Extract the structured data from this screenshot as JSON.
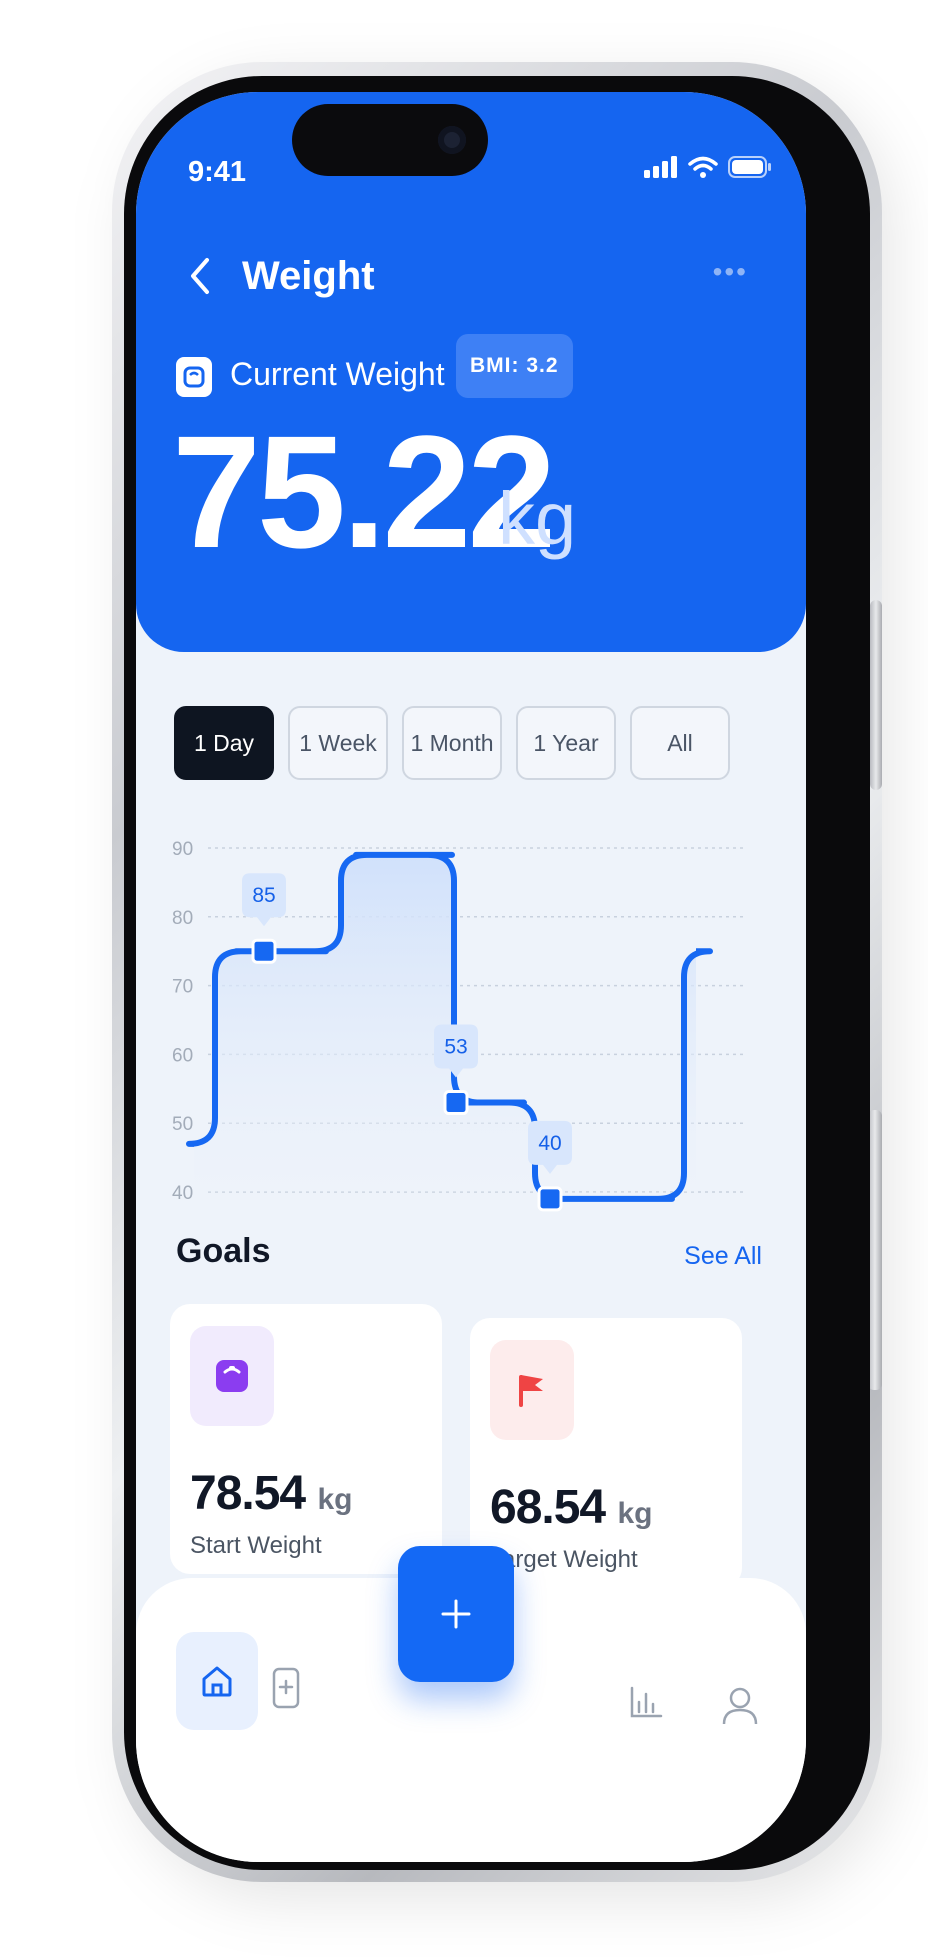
{
  "status": {
    "time": "9:41"
  },
  "header": {
    "title": "Weight",
    "more": "•••",
    "current_label": "Current Weight",
    "bmi": "BMI: 3.2",
    "weight_value": "75.22",
    "weight_unit": "kg"
  },
  "tabs": [
    "1 Day",
    "1 Week",
    "1 Month",
    "1 Year",
    "All"
  ],
  "active_tab": "1 Day",
  "chart_data": {
    "type": "area",
    "y_ticks": [
      "90",
      "80",
      "70",
      "60",
      "50",
      "40"
    ],
    "ylim": [
      40,
      90
    ],
    "grid": true,
    "x": [
      0,
      1,
      2,
      3,
      4,
      5,
      6,
      7,
      8,
      9
    ],
    "values": [
      47,
      75,
      75,
      89,
      89,
      53,
      53,
      39,
      39,
      75
    ],
    "callouts": [
      {
        "label": "85",
        "point_index": 2
      },
      {
        "label": "53",
        "point_index": 6
      },
      {
        "label": "40",
        "point_index": 8
      }
    ],
    "colors": {
      "line": "#1668f2",
      "fill": "#cfe0fb"
    }
  },
  "goals": {
    "title": "Goals",
    "see_all": "See All",
    "cards": [
      {
        "value": "78.54",
        "unit": "kg",
        "label": "Start Weight",
        "icon": "scale-icon",
        "color": "#8b3df0"
      },
      {
        "value": "68.54",
        "unit": "kg",
        "label": "Target Weight",
        "icon": "flag-icon",
        "color": "#ef4444"
      }
    ]
  },
  "nav": {
    "items": [
      "home-icon",
      "phone-plus-icon",
      "plus-icon",
      "chart-icon",
      "profile-icon"
    ],
    "accent": "#1565f0"
  }
}
